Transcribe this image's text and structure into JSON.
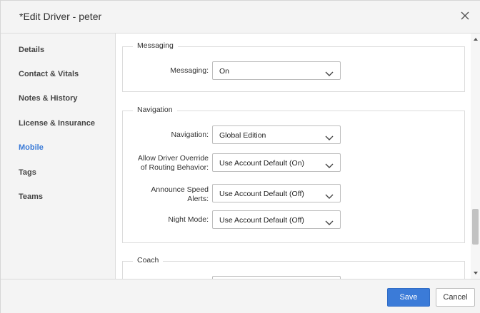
{
  "dialog": {
    "title": "*Edit Driver - peter",
    "close_icon": "close-icon"
  },
  "sidebar": {
    "items": [
      {
        "label": "Details"
      },
      {
        "label": "Contact & Vitals"
      },
      {
        "label": "Notes & History"
      },
      {
        "label": "License & Insurance"
      },
      {
        "label": "Mobile",
        "active": true
      },
      {
        "label": "Tags"
      },
      {
        "label": "Teams"
      }
    ]
  },
  "sections": {
    "messaging": {
      "legend": "Messaging",
      "messaging_label": "Messaging:",
      "messaging_value": "On"
    },
    "navigation": {
      "legend": "Navigation",
      "navigation_label": "Navigation:",
      "navigation_value": "Global Edition",
      "override_label_1": "Allow Driver Override",
      "override_label_2": "of Routing Behavior:",
      "override_value": "Use Account Default (On)",
      "speed_label_1": "Announce Speed",
      "speed_label_2": "Alerts:",
      "speed_value": "Use Account Default (Off)",
      "night_label": "Night Mode:",
      "night_value": "Use Account Default (Off)"
    },
    "coach": {
      "legend": "Coach"
    }
  },
  "footer": {
    "save_label": "Save",
    "cancel_label": "Cancel"
  },
  "colors": {
    "accent": "#3b7bd8",
    "panel_bg": "#f4f4f4",
    "border": "#dcdcdc"
  }
}
